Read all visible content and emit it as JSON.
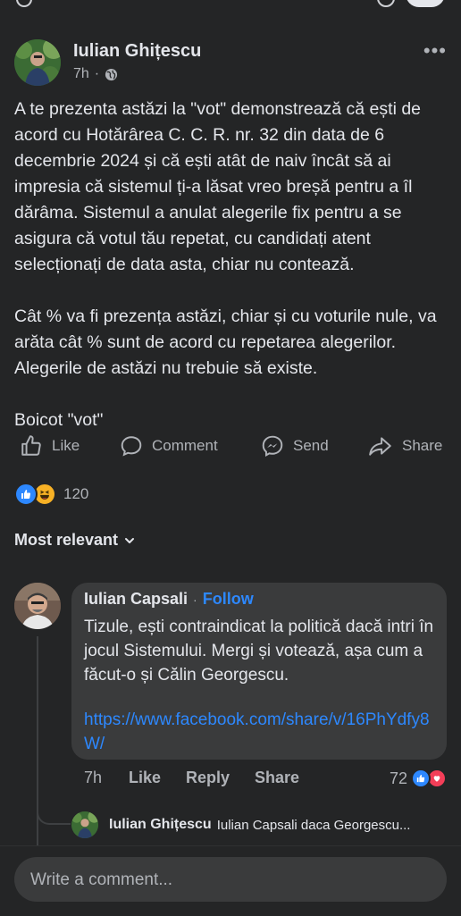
{
  "post": {
    "author": "Iulian Ghițescu",
    "time": "7h",
    "paragraphs": [
      "A te prezenta astăzi la \"vot\" demonstrează că ești de acord cu Hotărârea C. C. R. nr. 32 din data de 6 decembrie 2024 și că ești atât de naiv încât să ai impresia că sistemul ți-a lăsat vreo breșă pentru a îl dărâma. Sistemul a anulat alegerile fix pentru a se asigura că votul tău repetat, cu candidați atent selecționați de data asta, chiar nu contează.",
      "Cât % va fi prezența astăzi, chiar și cu voturile nule, va arăta cât % sunt de acord cu repetarea alegerilor. Alegerile de astăzi nu trebuie să existe.",
      "Boicot \"vot\""
    ]
  },
  "actions": {
    "like": "Like",
    "comment": "Comment",
    "send": "Send",
    "share": "Share"
  },
  "reactions": {
    "icons": [
      "like-icon",
      "haha-icon"
    ],
    "count": "120"
  },
  "comments_section": {
    "sort_label": "Most relevant"
  },
  "comment": {
    "author": "Iulian Capsali",
    "separator": "·",
    "follow": "Follow",
    "text": "Tizule, ești contraindicat la politică dacă intri în jocul Sistemului. Mergi și votează, așa cum a făcut-o și Călin Georgescu.",
    "link": "https://www.facebook.com/share/v/16PhYdfy8W/",
    "time": "7h",
    "like": "Like",
    "reply": "Reply",
    "share": "Share",
    "reaction_count": "72",
    "reaction_icons": [
      "like-icon",
      "love-icon"
    ]
  },
  "reply": {
    "author": "Iulian Ghițescu",
    "text": "Iulian Capsali daca Georgescu..."
  },
  "composer": {
    "placeholder": "Write a comment..."
  },
  "colors": {
    "background": "#242526",
    "bubble": "#3a3b3c",
    "text": "#e4e6eb",
    "secondary": "#b0b3b8",
    "link": "#2d88ff",
    "love": "#f33e58",
    "haha": "#f7b125"
  }
}
